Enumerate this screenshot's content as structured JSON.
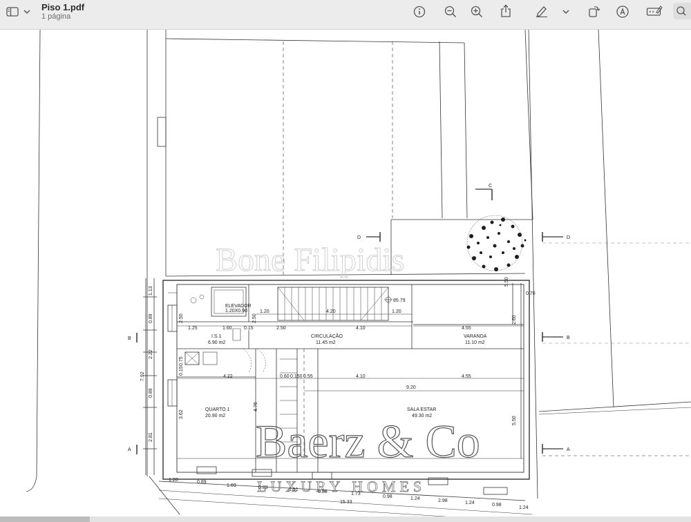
{
  "window": {
    "file_name": "Piso 1.pdf",
    "page_count": "1 página"
  },
  "toolbar": {
    "sidebar_icon": "sidebar-icon",
    "chevron_icon": "chevron-down-icon",
    "info_icon": "info-icon",
    "zoom_out_icon": "zoom-out-icon",
    "zoom_in_icon": "zoom-in-icon",
    "share_icon": "share-icon",
    "markup_icon": "pen-icon",
    "rotate_icon": "rotate-icon",
    "annotate_icon": "annotate-icon",
    "form_icon": "form-icon",
    "search_icon": "search-icon"
  },
  "plan": {
    "section_marks": {
      "c": "C",
      "d": "D",
      "b": "B",
      "a": "A"
    },
    "rooms": {
      "elevador": "ELEVADOR",
      "elevador_size": "1.20X0.90",
      "is1": "I.S.1",
      "is1_area": "6.90 m2",
      "circulacao": "CIRCULAÇÃO",
      "circulacao_area": "11.45 m2",
      "varanda": "VARANDA",
      "varanda_area": "11.10 m2",
      "quarto": "QUARTO 1",
      "quarto_area": "20.90 m2",
      "sala": "SALA ESTAR",
      "sala_area": "49.30 m2"
    },
    "level": "85.79",
    "dims": {
      "d_120a": "1.20",
      "d_420": "4.20",
      "d_120b": "1.20",
      "d_125": "1.25",
      "d_160": "1.60",
      "d_015": "0.15",
      "d_250h": "2.50",
      "d_410a": "4.10",
      "d_455a": "4.55",
      "d_422": "4.22",
      "d_060": "0.60",
      "d_0150": "0.150",
      "d_055": "0.55",
      "d_410b": "4.10",
      "d_455b": "4.55",
      "d_920": "9.20",
      "d_250v1": "2.50",
      "d_250v2": "2.50",
      "d_260": "2.60",
      "d_550a": "5.50",
      "d_070": "0.70",
      "d_550b": "5.50",
      "d_362": "3.62",
      "d_476": "4.76",
      "d_113": "1.13",
      "d_089a": "0.89",
      "d_222": "2.22",
      "d_792": "7.92",
      "d_089b": "0.89",
      "d_281": "2.81",
      "d_075": "0.75",
      "d_015v": "0.15",
      "b_120": "1.20",
      "b_089a": "0.89",
      "b_169": "1.69",
      "b_089b": "0.89",
      "b_151": "1.51",
      "b_089c": "0.89",
      "b_173": "1.73",
      "b_098a": "0.98",
      "b_124a": "1.24",
      "b_298": "2.98",
      "b_124b": "1.24",
      "b_098b": "0.98",
      "b_124c": "1.24",
      "b_1533": "15.33"
    },
    "watermark_top": "Bone Filipidis",
    "watermark_brand": "Baerz & Co",
    "watermark_sub": "LUXURY HOMES"
  }
}
